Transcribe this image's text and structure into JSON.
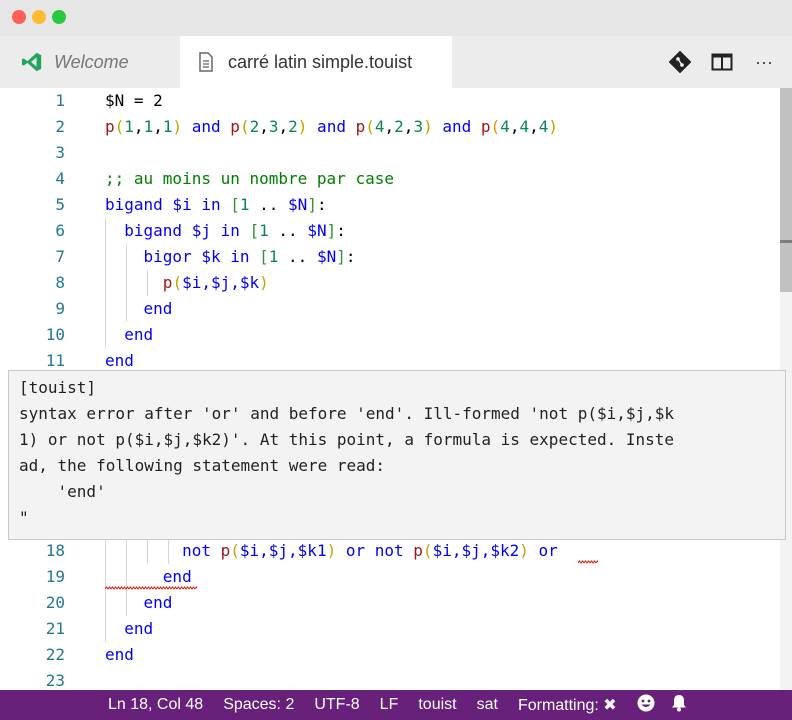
{
  "window": {
    "lights": [
      "#ff5f57",
      "#febc2e",
      "#28c840"
    ]
  },
  "tabs": [
    {
      "label": "Welcome",
      "icon": "vscode-logo-icon",
      "active": false
    },
    {
      "label": "carré latin simple.touist",
      "icon": "file-icon",
      "active": true
    }
  ],
  "actions": [
    {
      "icon": "git-compare-icon"
    },
    {
      "icon": "split-editor-icon"
    },
    {
      "icon": "more-icon",
      "glyph": "···"
    }
  ],
  "editor": {
    "lines": [
      {
        "num": "1",
        "tokens": [
          [
            "$N = 2",
            "tx"
          ]
        ]
      },
      {
        "num": "2",
        "tokens": [
          [
            "p",
            "fn"
          ],
          [
            "(",
            "pa"
          ],
          [
            "1",
            "num"
          ],
          [
            ",",
            "tx"
          ],
          [
            "1",
            "num"
          ],
          [
            ",",
            "tx"
          ],
          [
            "1",
            "num"
          ],
          [
            ")",
            "pa"
          ],
          [
            " and ",
            "kw"
          ],
          [
            "p",
            "fn"
          ],
          [
            "(",
            "pa"
          ],
          [
            "2",
            "num"
          ],
          [
            ",",
            "tx"
          ],
          [
            "3",
            "num"
          ],
          [
            ",",
            "tx"
          ],
          [
            "2",
            "num"
          ],
          [
            ")",
            "pa"
          ],
          [
            " and ",
            "kw"
          ],
          [
            "p",
            "fn"
          ],
          [
            "(",
            "pa"
          ],
          [
            "4",
            "num"
          ],
          [
            ",",
            "tx"
          ],
          [
            "2",
            "num"
          ],
          [
            ",",
            "tx"
          ],
          [
            "3",
            "num"
          ],
          [
            ")",
            "pa"
          ],
          [
            " and ",
            "kw"
          ],
          [
            "p",
            "fn"
          ],
          [
            "(",
            "pa"
          ],
          [
            "4",
            "num"
          ],
          [
            ",",
            "tx"
          ],
          [
            "4",
            "num"
          ],
          [
            ",",
            "tx"
          ],
          [
            "4",
            "num"
          ],
          [
            ")",
            "pa"
          ]
        ]
      },
      {
        "num": "3",
        "tokens": []
      },
      {
        "num": "4",
        "tokens": [
          [
            ";; au moins un nombre par case",
            "cm"
          ]
        ]
      },
      {
        "num": "5",
        "tokens": [
          [
            "bigand $i in ",
            "kw"
          ],
          [
            "[",
            "br"
          ],
          [
            "1",
            "num"
          ],
          [
            " .. ",
            "tx"
          ],
          [
            "$N",
            "kw"
          ],
          [
            "]",
            "br"
          ],
          [
            ":",
            "tx"
          ]
        ]
      },
      {
        "num": "6",
        "tokens": [
          [
            "  bigand $j in ",
            "kw"
          ],
          [
            "[",
            "br"
          ],
          [
            "1",
            "num"
          ],
          [
            " .. ",
            "tx"
          ],
          [
            "$N",
            "kw"
          ],
          [
            "]",
            "br"
          ],
          [
            ":",
            "tx"
          ]
        ]
      },
      {
        "num": "7",
        "tokens": [
          [
            "    bigor $k in ",
            "kw"
          ],
          [
            "[",
            "br"
          ],
          [
            "1",
            "num"
          ],
          [
            " .. ",
            "tx"
          ],
          [
            "$N",
            "kw"
          ],
          [
            "]",
            "br"
          ],
          [
            ":",
            "tx"
          ]
        ]
      },
      {
        "num": "8",
        "tokens": [
          [
            "      p",
            "fn"
          ],
          [
            "(",
            "pa"
          ],
          [
            "$i,$j,$k",
            "kw"
          ],
          [
            ")",
            "pa"
          ]
        ]
      },
      {
        "num": "9",
        "tokens": [
          [
            "    end",
            "kw"
          ]
        ]
      },
      {
        "num": "10",
        "tokens": [
          [
            "  end",
            "kw"
          ]
        ]
      },
      {
        "num": "11",
        "tokens": [
          [
            "end",
            "kw"
          ]
        ]
      },
      {
        "num": "18",
        "tokens": [
          [
            "        not ",
            "kw"
          ],
          [
            "p",
            "fn"
          ],
          [
            "(",
            "pa"
          ],
          [
            "$i,$j,$k1",
            "kw"
          ],
          [
            ")",
            "pa"
          ],
          [
            " or not ",
            "kw"
          ],
          [
            "p",
            "fn"
          ],
          [
            "(",
            "pa"
          ],
          [
            "$i,$j,$k2",
            "kw"
          ],
          [
            ")",
            "pa"
          ],
          [
            " or",
            "kw"
          ]
        ]
      },
      {
        "num": "19",
        "tokens": [
          [
            "      end",
            "kw"
          ]
        ]
      },
      {
        "num": "20",
        "tokens": [
          [
            "    end",
            "kw"
          ]
        ]
      },
      {
        "num": "21",
        "tokens": [
          [
            "  end",
            "kw"
          ]
        ]
      },
      {
        "num": "22",
        "tokens": [
          [
            "end",
            "kw"
          ]
        ]
      },
      {
        "num": "23",
        "tokens": []
      }
    ]
  },
  "hover": {
    "lines": [
      "[touist]",
      "syntax error after 'or' and before 'end'. Ill-formed 'not p($i,$j,$k",
      "1) or not p($i,$j,$k2)'. At this point, a formula is expected. Inste",
      "ad, the following statement were read:",
      "    'end'",
      "\""
    ]
  },
  "statusbar": {
    "items": [
      "Ln 18, Col 48",
      "Spaces: 2",
      "UTF-8",
      "LF",
      "touist",
      "sat",
      "Formatting: ✖"
    ],
    "icons": [
      "smiley-feedback-icon",
      "bell-notification-icon"
    ],
    "color": "#68217a"
  }
}
